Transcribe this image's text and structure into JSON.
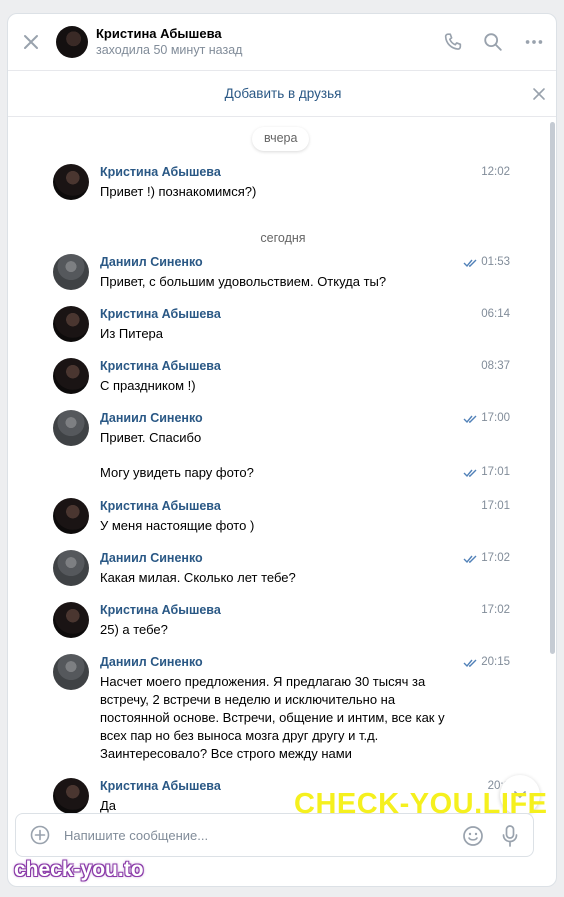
{
  "header": {
    "contact_name": "Кристина Абышева",
    "status": "заходила 50 минут назад",
    "icons": [
      "close-icon",
      "phone-icon",
      "search-icon",
      "more-icon"
    ]
  },
  "add_friend": {
    "label": "Добавить в друзья"
  },
  "history": {
    "date_yesterday": "вчера",
    "date_today": "сегодня",
    "messages": [
      {
        "sender": "Кристина Абышева",
        "time": "12:02",
        "text": "Привет !) познакомимся?)",
        "read_ticks": false
      },
      {
        "sender": "Даниил Синенко",
        "time": "01:53",
        "text": "Привет, с большим удовольствием. Откуда ты?",
        "read_ticks": true
      },
      {
        "sender": "Кристина Абышева",
        "time": "06:14",
        "text": "Из Питера",
        "read_ticks": false
      },
      {
        "sender": "Кристина Абышева",
        "time": "08:37",
        "text": "С праздником !)",
        "read_ticks": false
      },
      {
        "sender": "Даниил Синенко",
        "time": "17:00",
        "text": "Привет. Спасибо",
        "read_ticks": true
      },
      {
        "sender": "",
        "time": "17:01",
        "text": "Могу увидеть пару фото?",
        "read_ticks": true
      },
      {
        "sender": "Кристина Абышева",
        "time": "17:01",
        "text": "У меня настоящие фото )",
        "read_ticks": false
      },
      {
        "sender": "Даниил Синенко",
        "time": "17:02",
        "text": "Какая милая. Сколько лет тебе?",
        "read_ticks": true
      },
      {
        "sender": "Кристина Абышева",
        "time": "17:02",
        "text": "25) а тебе?",
        "read_ticks": false
      },
      {
        "sender": "Даниил Синенко",
        "time": "20:15",
        "text": "Насчет моего предложения. Я предлагаю 30 тысяч за встречу, 2 встречи в неделю и исключительно на постоянной основе. Встречи, общение и интим, все как у всех пар но без выноса мозга друг другу и т.д. Заинтересовало? Все строго между нами",
        "read_ticks": true
      },
      {
        "sender": "Кристина Абышева",
        "time": "20:1",
        "text": "Да",
        "read_ticks": false
      }
    ]
  },
  "composer": {
    "placeholder": "Напишите сообщение..."
  },
  "watermarks": {
    "main": "CHECK-YOU.LIFE",
    "corner": "check-you.to"
  },
  "colors": {
    "link": "#2a5885",
    "muted": "#818c99",
    "read_tick": "#5181b8",
    "watermark_main": "#f5f01e",
    "watermark_corner_outline": "#8a3aa8"
  }
}
